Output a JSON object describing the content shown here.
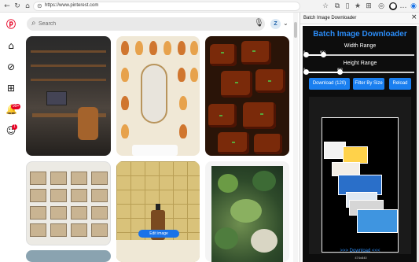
{
  "browser": {
    "url": "https://www.pinterest.com",
    "icons": [
      "back-icon",
      "refresh-icon",
      "home-icon",
      "lock-icon",
      "star-icon",
      "extensions-icon",
      "profile-icon",
      "settings-icon"
    ]
  },
  "rail": {
    "badges": {
      "notifications": "99+",
      "messages": "1"
    }
  },
  "search": {
    "placeholder": "Search",
    "value": ""
  },
  "user": {
    "avatar_initial": "Z"
  },
  "pins": {
    "pin4_label": "",
    "edit_image_label": "Edit image"
  },
  "extension": {
    "header_title": "Batch Image Downloader",
    "title": "Batch Image Downloader",
    "width_label": "Width Range",
    "height_label": "Height Range",
    "width_min_value": "0",
    "width_max_value": "800",
    "height_min_value": "0",
    "height_max_value": "800",
    "width_range": [
      0.0,
      0.16
    ],
    "height_range": [
      0.0,
      0.31
    ],
    "download_button": "Download (120)",
    "filter_button": "Filter By Size",
    "reload_button": "Reload",
    "gallery_caption": "474x840",
    "download_link": ">>> Download <<<"
  },
  "colors": {
    "pinterest_red": "#e60023",
    "accent_blue": "#1a7ff0",
    "panel_bg": "#0d0d0d"
  }
}
